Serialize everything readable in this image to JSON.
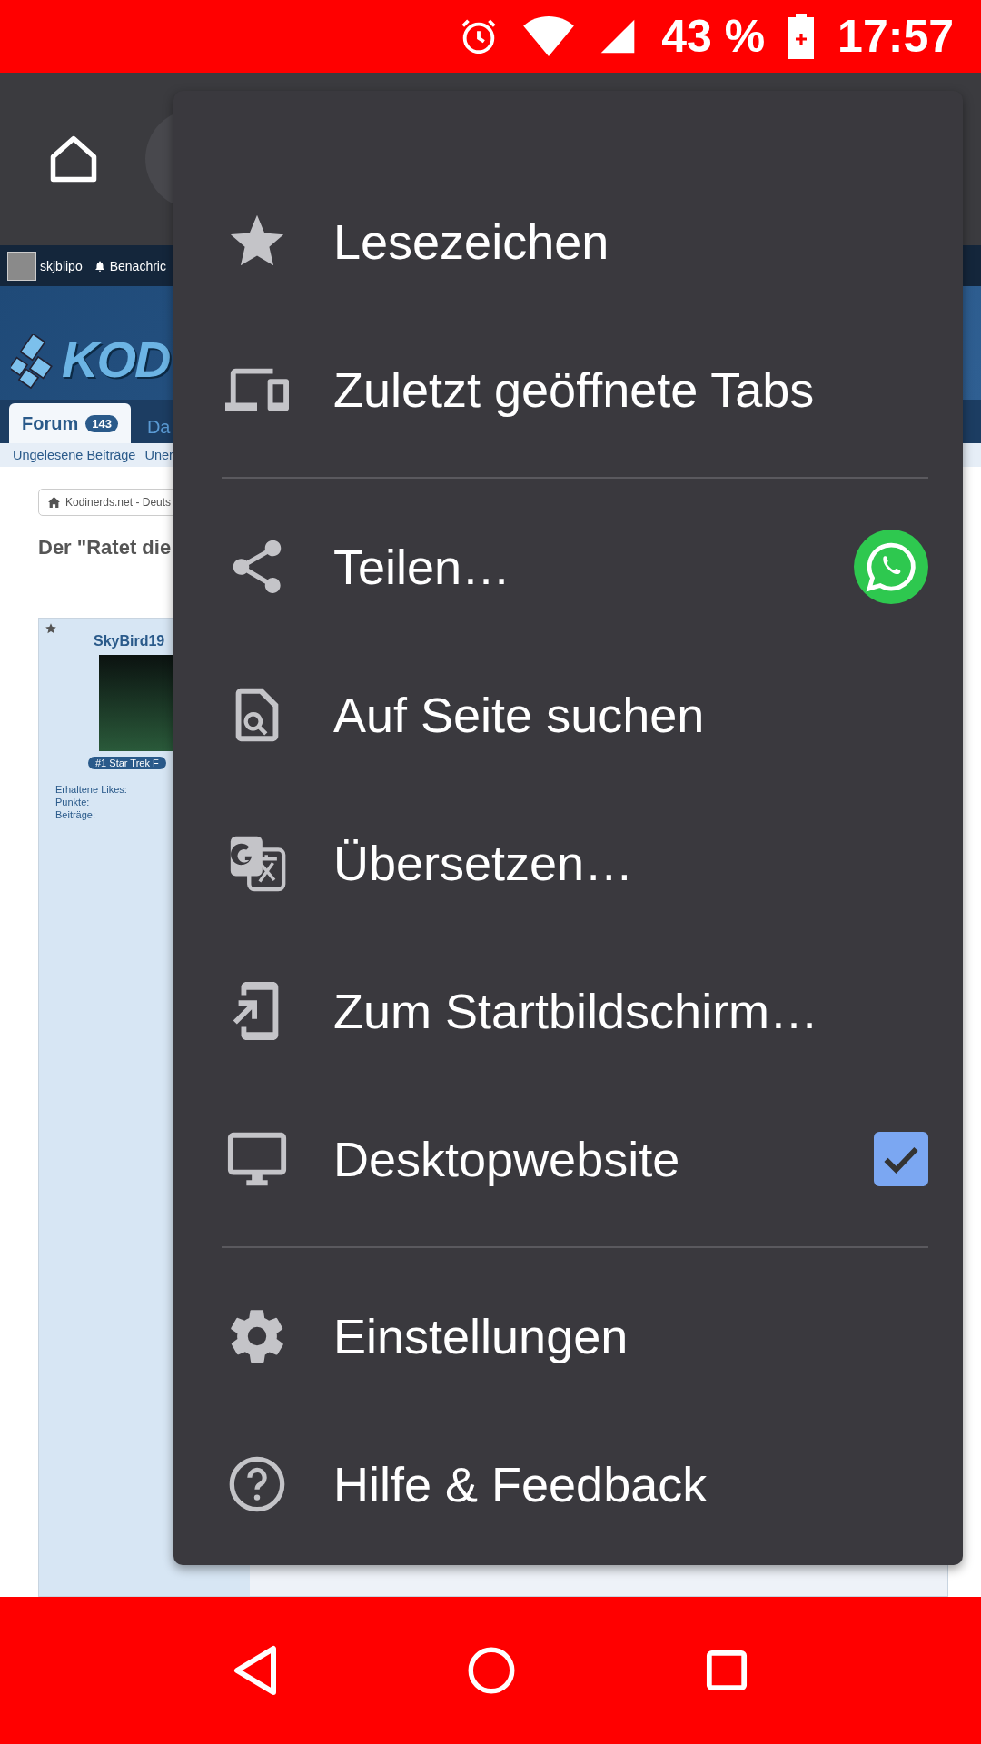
{
  "status_bar": {
    "battery": "43 %",
    "time": "17:57"
  },
  "page": {
    "user": "skjblipo",
    "notifications": "Benachric",
    "logo": "KOD",
    "tabs": [
      {
        "label": "Forum",
        "badge": "143",
        "selected": true
      },
      {
        "label": "Da",
        "selected": false
      }
    ],
    "subnav": [
      "Ungelesene Beiträge",
      "Uner"
    ],
    "breadcrumb": "Kodinerds.net - Deuts",
    "title": "Der \"Ratet die",
    "post": {
      "author": "SkyBird19",
      "rank": "#1 Star Trek F",
      "stats": [
        "Erhaltene Likes:",
        "Punkte:",
        "Beiträge:"
      ]
    }
  },
  "menu": {
    "items": [
      {
        "kind": "spacer"
      },
      {
        "kind": "item",
        "label": "Lesezeichen"
      },
      {
        "kind": "item",
        "label": "Zuletzt geöffnete Tabs"
      },
      {
        "kind": "divider"
      },
      {
        "kind": "share",
        "label": "Teilen…"
      },
      {
        "kind": "item",
        "label": "Auf Seite suchen"
      },
      {
        "kind": "item",
        "label": "Übersetzen…"
      },
      {
        "kind": "item",
        "label": "Zum Startbildschirm…"
      },
      {
        "kind": "toggle",
        "label": "Desktopwebsite",
        "checked": true
      },
      {
        "kind": "divider"
      },
      {
        "kind": "item",
        "label": "Einstellungen"
      },
      {
        "kind": "item",
        "label": "Hilfe & Feedback"
      }
    ]
  }
}
